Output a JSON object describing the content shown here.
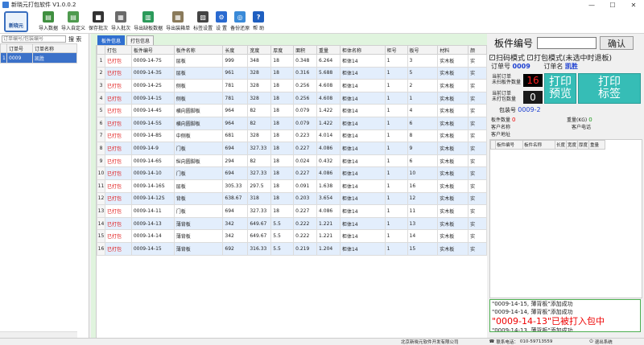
{
  "window": {
    "title": "新晓元打包软件 V1.0.0.2",
    "min": "—",
    "max": "☐",
    "close": "✕"
  },
  "logo_text": "新晓元",
  "toolbar": [
    {
      "label": "导入数据",
      "icon": "import-data-icon",
      "color": "#3f8f3f",
      "glyph": "▤"
    },
    {
      "label": "导入自定义",
      "icon": "import-custom-icon",
      "color": "#4e9a4e",
      "glyph": "▤"
    },
    {
      "label": "保存批次",
      "icon": "save-batch-icon",
      "color": "#333333",
      "glyph": "■"
    },
    {
      "label": "导入批次",
      "icon": "import-batch-icon",
      "color": "#6a6a6a",
      "glyph": "▦"
    },
    {
      "label": "导出缺板数据",
      "icon": "export-missing-icon",
      "color": "#2b9a5a",
      "glyph": "▥"
    },
    {
      "label": "导出装箱单",
      "icon": "export-packing-list-icon",
      "color": "#8a7a5a",
      "glyph": "▦"
    },
    {
      "label": "标签设置",
      "icon": "label-settings-icon",
      "color": "#444444",
      "glyph": "▨"
    },
    {
      "label": "设 置",
      "icon": "gear-icon",
      "color": "#2a6ad0",
      "glyph": "⚙"
    },
    {
      "label": "备份还原",
      "icon": "backup-restore-icon",
      "color": "#3a8ad8",
      "glyph": "◎"
    },
    {
      "label": "帮 助",
      "icon": "help-icon",
      "color": "#1f5fc0",
      "glyph": "?"
    }
  ],
  "left": {
    "search_placeholder": "订单编号/包装编号",
    "search_button": "搜 索",
    "columns": [
      "订单号",
      "订单名称"
    ],
    "rows": [
      {
        "num": "1",
        "order": "0009",
        "name": "凯胜"
      }
    ]
  },
  "tabs": [
    "板件信息",
    "打包信息"
  ],
  "grid": {
    "columns": [
      "打包",
      "板件编号",
      "板件名称",
      "长度",
      "宽度",
      "厚度",
      "面积",
      "重量",
      "柜体名称",
      "柜号",
      "板号",
      "材料",
      "颜"
    ],
    "rows": [
      [
        "1",
        "已打包",
        "0009-14-7S",
        "层板",
        "999",
        "348",
        "18",
        "0.348",
        "6.264",
        "柜体14",
        "1",
        "3",
        "实木板",
        "实"
      ],
      [
        "2",
        "已打包",
        "0009-14-3S",
        "层板",
        "961",
        "328",
        "18",
        "0.316",
        "5.688",
        "柜体14",
        "1",
        "5",
        "实木板",
        "实"
      ],
      [
        "3",
        "已打包",
        "0009-14-2S",
        "侧板",
        "781",
        "328",
        "18",
        "0.256",
        "4.608",
        "柜体14",
        "1",
        "2",
        "实木板",
        "实"
      ],
      [
        "4",
        "已打包",
        "0009-14-1S",
        "侧板",
        "781",
        "328",
        "18",
        "0.256",
        "4.608",
        "柜体14",
        "1",
        "1",
        "实木板",
        "实"
      ],
      [
        "5",
        "已打包",
        "0009-14-4S",
        "横向圆脚板",
        "964",
        "82",
        "18",
        "0.079",
        "1.422",
        "柜体14",
        "1",
        "4",
        "实木板",
        "实"
      ],
      [
        "6",
        "已打包",
        "0009-14-5S",
        "横向圆脚板",
        "964",
        "82",
        "18",
        "0.079",
        "1.422",
        "柜体14",
        "1",
        "6",
        "实木板",
        "实"
      ],
      [
        "7",
        "已打包",
        "0009-14-8S",
        "中侧板",
        "681",
        "328",
        "18",
        "0.223",
        "4.014",
        "柜体14",
        "1",
        "8",
        "实木板",
        "实"
      ],
      [
        "8",
        "已打包",
        "0009-14-9",
        "门板",
        "694",
        "327.33",
        "18",
        "0.227",
        "4.086",
        "柜体14",
        "1",
        "9",
        "实木板",
        "实"
      ],
      [
        "9",
        "已打包",
        "0009-14-6S",
        "纵向圆脚板",
        "294",
        "82",
        "18",
        "0.024",
        "0.432",
        "柜体14",
        "1",
        "6",
        "实木板",
        "实"
      ],
      [
        "10",
        "已打包",
        "0009-14-10",
        "门板",
        "694",
        "327.33",
        "18",
        "0.227",
        "4.086",
        "柜体14",
        "1",
        "10",
        "实木板",
        "实"
      ],
      [
        "11",
        "已打包",
        "0009-14-16S",
        "层板",
        "305.33",
        "297.5",
        "18",
        "0.091",
        "1.638",
        "柜体14",
        "1",
        "16",
        "实木板",
        "实"
      ],
      [
        "12",
        "已打包",
        "0009-14-12S",
        "背板",
        "638.67",
        "318",
        "18",
        "0.203",
        "3.654",
        "柜体14",
        "1",
        "12",
        "实木板",
        "实"
      ],
      [
        "13",
        "已打包",
        "0009-14-11",
        "门板",
        "694",
        "327.33",
        "18",
        "0.227",
        "4.086",
        "柜体14",
        "1",
        "11",
        "实木板",
        "实"
      ],
      [
        "14",
        "已打包",
        "0009-14-13",
        "薄背板",
        "342",
        "649.67",
        "5.5",
        "0.222",
        "1.221",
        "柜体14",
        "1",
        "13",
        "实木板",
        "实"
      ],
      [
        "15",
        "已打包",
        "0009-14-14",
        "薄背板",
        "342",
        "649.67",
        "5.5",
        "0.222",
        "1.221",
        "柜体14",
        "1",
        "14",
        "实木板",
        "实"
      ],
      [
        "16",
        "已打包",
        "0009-14-15",
        "薄背板",
        "692",
        "316.33",
        "5.5",
        "0.219",
        "1.204",
        "柜体14",
        "1",
        "15",
        "实木板",
        "实"
      ]
    ]
  },
  "right": {
    "part_no_label": "板件编号",
    "confirm": "确认",
    "scan_mode": "扫码模式",
    "pack_mode": "打包模式(未选中时退板)",
    "order_no_label": "订单号",
    "order_no": "0009",
    "order_name_label": "订单名",
    "order_name": "凯胜",
    "cur_order_unscanned": "当前订单\n未扫板件数量",
    "cur_order_unscanned_val": "16",
    "cur_order_unpacked": "当前订单\n未打包数量",
    "cur_order_unpacked_val": "0",
    "print_preview": "打印\n预览",
    "print_label": "打印\n标签",
    "pkg_no_label": "包装号",
    "pkg_no": "0009-2",
    "part_count_label": "板件数量",
    "part_count": "0",
    "weight_label": "重量(KG)",
    "weight": "0",
    "customer_name": "客户名称",
    "customer_phone": "客户电话",
    "customer_addr": "客户地址",
    "sub_columns": [
      "板件编号",
      "板件名称",
      "长度",
      "宽度",
      "厚度",
      "重量"
    ],
    "log": [
      {
        "text": "\"0009-14-15, 薄背板\"添加成功",
        "hl": false
      },
      {
        "text": "\"0009-14-14, 薄背板\"添加成功",
        "hl": false
      },
      {
        "text": "\"0009-14-13\"已被打入包中",
        "hl": true
      },
      {
        "text": "\"0009-14-13, 薄背板\"添加成功",
        "hl": false
      }
    ]
  },
  "status": {
    "company": "北京新晓元软件开发有限公司",
    "contact": "联系电话：",
    "phone": "010-59713559",
    "exit": "退出系统"
  }
}
